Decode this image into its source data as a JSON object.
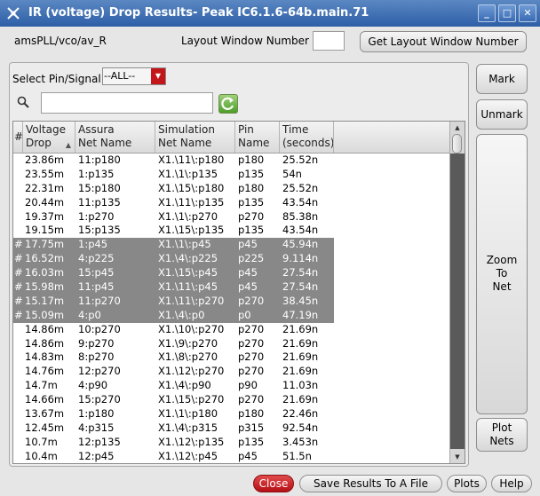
{
  "window": {
    "title": "IR (voltage) Drop Results- Peak IC6.1.6-64b.main.71",
    "buttons": {
      "minimize": "_",
      "maximize": "□",
      "close": "✕"
    }
  },
  "header": {
    "cell_path": "amsPLL/vco/av_R",
    "layout_window_label": "Layout Window Number",
    "layout_window_value": "",
    "get_layout_button": "Get Layout Window Number"
  },
  "filter": {
    "select_label": "Select Pin/Signal:",
    "select_value": "--ALL--",
    "search_value": ""
  },
  "table": {
    "columns": [
      {
        "line1": "#",
        "line2": ""
      },
      {
        "line1": "Voltage",
        "line2": "Drop"
      },
      {
        "line1": "Assura",
        "line2": "Net Name"
      },
      {
        "line1": "Simulation",
        "line2": "Net Name"
      },
      {
        "line1": "Pin",
        "line2": "Name"
      },
      {
        "line1": "Time",
        "line2": "(seconds)"
      }
    ],
    "rows": [
      {
        "mark": "",
        "drop": "23.86m",
        "assura": "11:p180",
        "sim": "X1.\\11\\:p180",
        "pin": "p180",
        "time": "25.52n",
        "selected": false
      },
      {
        "mark": "",
        "drop": "23.55m",
        "assura": "1:p135",
        "sim": "X1.\\1\\:p135",
        "pin": "p135",
        "time": "54n",
        "selected": false
      },
      {
        "mark": "",
        "drop": "22.31m",
        "assura": "15:p180",
        "sim": "X1.\\15\\:p180",
        "pin": "p180",
        "time": "25.52n",
        "selected": false
      },
      {
        "mark": "",
        "drop": "20.44m",
        "assura": "11:p135",
        "sim": "X1.\\11\\:p135",
        "pin": "p135",
        "time": "43.54n",
        "selected": false
      },
      {
        "mark": "",
        "drop": "19.37m",
        "assura": "1:p270",
        "sim": "X1.\\1\\:p270",
        "pin": "p270",
        "time": "85.38n",
        "selected": false
      },
      {
        "mark": "",
        "drop": "19.15m",
        "assura": "15:p135",
        "sim": "X1.\\15\\:p135",
        "pin": "p135",
        "time": "43.54n",
        "selected": false
      },
      {
        "mark": "#",
        "drop": "17.75m",
        "assura": "1:p45",
        "sim": "X1.\\1\\:p45",
        "pin": "p45",
        "time": "45.94n",
        "selected": true
      },
      {
        "mark": "#",
        "drop": "16.52m",
        "assura": "4:p225",
        "sim": "X1.\\4\\:p225",
        "pin": "p225",
        "time": "9.114n",
        "selected": true
      },
      {
        "mark": "#",
        "drop": "16.03m",
        "assura": "15:p45",
        "sim": "X1.\\15\\:p45",
        "pin": "p45",
        "time": "27.54n",
        "selected": true
      },
      {
        "mark": "#",
        "drop": "15.98m",
        "assura": "11:p45",
        "sim": "X1.\\11\\:p45",
        "pin": "p45",
        "time": "27.54n",
        "selected": true
      },
      {
        "mark": "#",
        "drop": "15.17m",
        "assura": "11:p270",
        "sim": "X1.\\11\\:p270",
        "pin": "p270",
        "time": "38.45n",
        "selected": true
      },
      {
        "mark": "#",
        "drop": "15.09m",
        "assura": "4:p0",
        "sim": "X1.\\4\\:p0",
        "pin": "p0",
        "time": "47.19n",
        "selected": true
      },
      {
        "mark": "",
        "drop": "14.86m",
        "assura": "10:p270",
        "sim": "X1.\\10\\:p270",
        "pin": "p270",
        "time": "21.69n",
        "selected": false
      },
      {
        "mark": "",
        "drop": "14.86m",
        "assura": "9:p270",
        "sim": "X1.\\9\\:p270",
        "pin": "p270",
        "time": "21.69n",
        "selected": false
      },
      {
        "mark": "",
        "drop": "14.83m",
        "assura": "8:p270",
        "sim": "X1.\\8\\:p270",
        "pin": "p270",
        "time": "21.69n",
        "selected": false
      },
      {
        "mark": "",
        "drop": "14.76m",
        "assura": "12:p270",
        "sim": "X1.\\12\\:p270",
        "pin": "p270",
        "time": "21.69n",
        "selected": false
      },
      {
        "mark": "",
        "drop": "14.7m",
        "assura": "4:p90",
        "sim": "X1.\\4\\:p90",
        "pin": "p90",
        "time": "11.03n",
        "selected": false
      },
      {
        "mark": "",
        "drop": "14.66m",
        "assura": "15:p270",
        "sim": "X1.\\15\\:p270",
        "pin": "p270",
        "time": "21.69n",
        "selected": false
      },
      {
        "mark": "",
        "drop": "13.67m",
        "assura": "1:p180",
        "sim": "X1.\\1\\:p180",
        "pin": "p180",
        "time": "22.46n",
        "selected": false
      },
      {
        "mark": "",
        "drop": "12.45m",
        "assura": "4:p315",
        "sim": "X1.\\4\\:p315",
        "pin": "p315",
        "time": "92.54n",
        "selected": false
      },
      {
        "mark": "",
        "drop": "10.7m",
        "assura": "12:p135",
        "sim": "X1.\\12\\:p135",
        "pin": "p135",
        "time": "3.453n",
        "selected": false
      },
      {
        "mark": "",
        "drop": "10.4m",
        "assura": "12:p45",
        "sim": "X1.\\12\\:p45",
        "pin": "p45",
        "time": "51.5n",
        "selected": false
      }
    ]
  },
  "side_buttons": {
    "mark": "Mark",
    "unmark": "Unmark",
    "zoom_to_net": [
      "Zoom",
      "To",
      "Net"
    ],
    "plot_nets": [
      "Plot",
      "Nets"
    ]
  },
  "footer": {
    "close": "Close",
    "save": "Save Results To A File",
    "plots": "Plots",
    "help": "Help"
  },
  "colors": {
    "title_bar": "#2d5ea7",
    "selected_row": "#888888",
    "close_button": "#c4151b"
  }
}
